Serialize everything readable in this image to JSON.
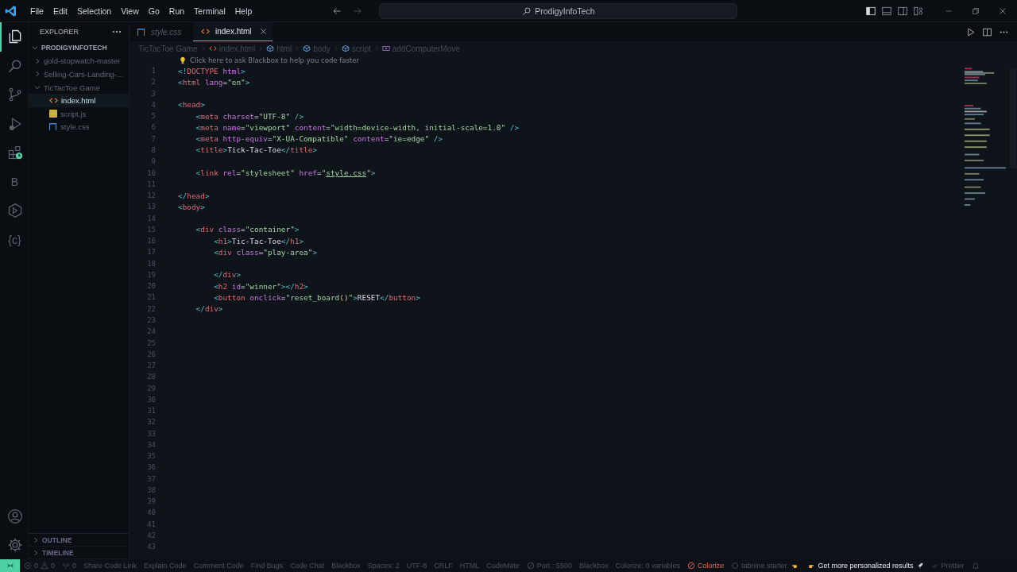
{
  "menu": [
    "File",
    "Edit",
    "Selection",
    "View",
    "Go",
    "Run",
    "Terminal",
    "Help"
  ],
  "command_center": {
    "value": "ProdigyInfoTech"
  },
  "layout_buttons": [
    {
      "kind": "sidebar-left",
      "on": true
    },
    {
      "kind": "panel",
      "on": false
    },
    {
      "kind": "sidebar-right",
      "on": false
    },
    {
      "kind": "layout",
      "on": false
    }
  ],
  "activity_bar": [
    {
      "kind": "files",
      "selected": true
    },
    {
      "kind": "search",
      "selected": false
    },
    {
      "kind": "branch",
      "selected": false
    },
    {
      "kind": "debug",
      "selected": false
    },
    {
      "kind": "extensions",
      "selected": false
    },
    {
      "kind": "letter",
      "label": "B",
      "selected": false
    },
    {
      "kind": "cube",
      "selected": false
    },
    {
      "kind": "letter",
      "label": "{c}",
      "selected": false
    }
  ],
  "activity_bottom": [
    {
      "kind": "account"
    },
    {
      "kind": "gear"
    }
  ],
  "sidebar": {
    "title": "EXPLORER",
    "root": {
      "label": "PRODIGYINFOTECH",
      "expanded": true,
      "children": [
        {
          "label": "gold-stopwatch-master",
          "kind": "folder",
          "expanded": false,
          "selected": false
        },
        {
          "label": "Selling-Cars-Landing-...",
          "kind": "folder",
          "expanded": false,
          "selected": false
        },
        {
          "label": "TicTacToe Game",
          "kind": "folder",
          "expanded": true,
          "selected": false,
          "children": [
            {
              "label": "index.html",
              "kind": "html",
              "selected": true
            },
            {
              "label": "script.js",
              "kind": "js",
              "selected": false
            },
            {
              "label": "style.css",
              "kind": "css",
              "selected": false
            }
          ]
        }
      ]
    },
    "sections": [
      {
        "label": "OUTLINE",
        "expanded": false
      },
      {
        "label": "TIMELINE",
        "expanded": false
      }
    ]
  },
  "tabs": [
    {
      "label": "style.css",
      "kind": "css",
      "preview": true,
      "selected": false
    },
    {
      "label": "index.html",
      "kind": "html",
      "preview": false,
      "selected": true
    }
  ],
  "breadcrumbs": [
    {
      "label": "TicTacToe Game",
      "kind": "folder"
    },
    {
      "label": "index.html",
      "kind": "html"
    },
    {
      "label": "html",
      "kind": "element"
    },
    {
      "label": "body",
      "kind": "element"
    },
    {
      "label": "script",
      "kind": "element"
    },
    {
      "label": "addComputerMove",
      "kind": "function"
    }
  ],
  "codelens": "Click here to ask Blackbox to help you code faster",
  "code_lines": [
    {
      "number": "1",
      "tokens": [
        {
          "kind": "br",
          "text": "<!"
        },
        {
          "kind": "tag",
          "text": "DOCTYPE"
        },
        {
          "kind": "attr",
          "text": " html"
        },
        {
          "kind": "br",
          "text": ">"
        }
      ]
    },
    {
      "number": "2",
      "tokens": [
        {
          "kind": "br",
          "text": "<"
        },
        {
          "kind": "tag",
          "text": "html"
        },
        {
          "kind": "attr",
          "text": " lang"
        },
        {
          "kind": "txt",
          "text": "="
        },
        {
          "kind": "str",
          "text": "\"en\""
        },
        {
          "kind": "br",
          "text": ">"
        }
      ]
    },
    {
      "number": "3"
    },
    {
      "number": "4",
      "tokens": [
        {
          "kind": "br",
          "text": "<"
        },
        {
          "kind": "tag",
          "text": "head"
        },
        {
          "kind": "br",
          "text": ">"
        }
      ]
    },
    {
      "number": "5",
      "tokens": [
        {
          "kind": "br",
          "text": "    <"
        },
        {
          "kind": "tag",
          "text": "meta"
        },
        {
          "kind": "attr",
          "text": " charset"
        },
        {
          "kind": "txt",
          "text": "="
        },
        {
          "kind": "str",
          "text": "\"UTF-8\""
        },
        {
          "kind": "br",
          "text": " />"
        }
      ]
    },
    {
      "number": "6",
      "tokens": [
        {
          "kind": "br",
          "text": "    <"
        },
        {
          "kind": "tag",
          "text": "meta"
        },
        {
          "kind": "attr",
          "text": " name"
        },
        {
          "kind": "txt",
          "text": "="
        },
        {
          "kind": "str",
          "text": "\"viewport\""
        },
        {
          "kind": "attr",
          "text": " content"
        },
        {
          "kind": "txt",
          "text": "="
        },
        {
          "kind": "str",
          "text": "\"width=device-width, initial-scale=1.0\""
        },
        {
          "kind": "br",
          "text": " />"
        }
      ]
    },
    {
      "number": "7",
      "tokens": [
        {
          "kind": "br",
          "text": "    <"
        },
        {
          "kind": "tag",
          "text": "meta"
        },
        {
          "kind": "attr",
          "text": " http-equiv"
        },
        {
          "kind": "txt",
          "text": "="
        },
        {
          "kind": "str",
          "text": "\"X-UA-Compatible\""
        },
        {
          "kind": "attr",
          "text": " content"
        },
        {
          "kind": "txt",
          "text": "="
        },
        {
          "kind": "str",
          "text": "\"ie=edge\""
        },
        {
          "kind": "br",
          "text": " />"
        }
      ]
    },
    {
      "number": "8",
      "tokens": [
        {
          "kind": "br",
          "text": "    <"
        },
        {
          "kind": "tag",
          "text": "title"
        },
        {
          "kind": "br",
          "text": ">"
        },
        {
          "kind": "txt",
          "text": "Tick-Tac-Toe"
        },
        {
          "kind": "br",
          "text": "</"
        },
        {
          "kind": "tag",
          "text": "title"
        },
        {
          "kind": "br",
          "text": ">"
        }
      ]
    },
    {
      "number": "9"
    },
    {
      "number": "10",
      "tokens": [
        {
          "kind": "br",
          "text": "    <"
        },
        {
          "kind": "tag",
          "text": "link"
        },
        {
          "kind": "attr",
          "text": " rel"
        },
        {
          "kind": "txt",
          "text": "="
        },
        {
          "kind": "str",
          "text": "\"stylesheet\""
        },
        {
          "kind": "attr",
          "text": " href"
        },
        {
          "kind": "txt",
          "text": "="
        },
        {
          "kind": "str",
          "text": "\""
        },
        {
          "kind": "link",
          "text": "style.css"
        },
        {
          "kind": "str",
          "text": "\""
        },
        {
          "kind": "br",
          "text": ">"
        }
      ]
    },
    {
      "number": "11"
    },
    {
      "number": "12",
      "tokens": [
        {
          "kind": "br",
          "text": "</"
        },
        {
          "kind": "tag",
          "text": "head"
        },
        {
          "kind": "br",
          "text": ">"
        }
      ]
    },
    {
      "number": "13",
      "tokens": [
        {
          "kind": "br",
          "text": "<"
        },
        {
          "kind": "tag",
          "text": "body"
        },
        {
          "kind": "br",
          "text": ">"
        }
      ]
    },
    {
      "number": "14"
    },
    {
      "number": "15",
      "tokens": [
        {
          "kind": "br",
          "text": "    <"
        },
        {
          "kind": "tag",
          "text": "div"
        },
        {
          "kind": "attr",
          "text": " class"
        },
        {
          "kind": "txt",
          "text": "="
        },
        {
          "kind": "str",
          "text": "\"container\""
        },
        {
          "kind": "br",
          "text": ">"
        }
      ]
    },
    {
      "number": "16",
      "tokens": [
        {
          "kind": "br",
          "text": "        <"
        },
        {
          "kind": "tag",
          "text": "h1"
        },
        {
          "kind": "br",
          "text": ">"
        },
        {
          "kind": "txt",
          "text": "Tic-Tac-Toe"
        },
        {
          "kind": "br",
          "text": "</"
        },
        {
          "kind": "tag",
          "text": "h1"
        },
        {
          "kind": "br",
          "text": ">"
        }
      ]
    },
    {
      "number": "17",
      "tokens": [
        {
          "kind": "br",
          "text": "        <"
        },
        {
          "kind": "tag",
          "text": "div"
        },
        {
          "kind": "attr",
          "text": " class"
        },
        {
          "kind": "txt",
          "text": "="
        },
        {
          "kind": "str",
          "text": "\"play-area\""
        },
        {
          "kind": "br",
          "text": ">"
        }
      ]
    },
    {
      "number": "18"
    },
    {
      "number": "19",
      "tokens": [
        {
          "kind": "br",
          "text": "        </"
        },
        {
          "kind": "tag",
          "text": "div"
        },
        {
          "kind": "br",
          "text": ">"
        }
      ]
    },
    {
      "number": "20",
      "tokens": [
        {
          "kind": "br",
          "text": "        <"
        },
        {
          "kind": "tag",
          "text": "h2"
        },
        {
          "kind": "attr",
          "text": " id"
        },
        {
          "kind": "txt",
          "text": "="
        },
        {
          "kind": "str",
          "text": "\"winner\""
        },
        {
          "kind": "br",
          "text": "></"
        },
        {
          "kind": "tag",
          "text": "h2"
        },
        {
          "kind": "br",
          "text": ">"
        }
      ]
    },
    {
      "number": "21",
      "tokens": [
        {
          "kind": "br",
          "text": "        <"
        },
        {
          "kind": "tag",
          "text": "button"
        },
        {
          "kind": "attr",
          "text": " onclick"
        },
        {
          "kind": "txt",
          "text": "="
        },
        {
          "kind": "str",
          "text": "\"reset_board"
        },
        {
          "kind": "paren",
          "text": "()"
        },
        {
          "kind": "str",
          "text": "\""
        },
        {
          "kind": "br",
          "text": ">"
        },
        {
          "kind": "txt",
          "text": "RESET"
        },
        {
          "kind": "br",
          "text": "</"
        },
        {
          "kind": "tag",
          "text": "button"
        },
        {
          "kind": "br",
          "text": ">"
        }
      ]
    },
    {
      "number": "22",
      "tokens": [
        {
          "kind": "br",
          "text": "    </"
        },
        {
          "kind": "tag",
          "text": "div"
        },
        {
          "kind": "br",
          "text": ">"
        }
      ]
    },
    {
      "number": "23"
    },
    {
      "number": "24"
    },
    {
      "number": "25"
    },
    {
      "number": "26"
    },
    {
      "number": "27"
    },
    {
      "number": "28"
    },
    {
      "number": "29"
    },
    {
      "number": "30"
    },
    {
      "number": "31"
    },
    {
      "number": "32"
    },
    {
      "number": "33"
    },
    {
      "number": "34"
    },
    {
      "number": "35"
    },
    {
      "number": "36"
    },
    {
      "number": "37"
    },
    {
      "number": "38"
    },
    {
      "number": "39"
    },
    {
      "number": "40"
    },
    {
      "number": "41"
    },
    {
      "number": "42"
    },
    {
      "number": "43"
    }
  ],
  "status_bar": [
    {
      "kind": "remote"
    },
    {
      "kind": "problems",
      "errors": "0",
      "warnings": "0"
    },
    {
      "kind": "ports",
      "text": "0"
    },
    {
      "kind": "text",
      "text": "Share Code Link"
    },
    {
      "kind": "text",
      "text": "Explain Code"
    },
    {
      "kind": "text",
      "text": "Comment Code"
    },
    {
      "kind": "text",
      "text": "Find Bugs"
    },
    {
      "kind": "text",
      "text": "Code Chat"
    },
    {
      "kind": "text",
      "text": "Blackbox"
    },
    {
      "kind": "text",
      "text": "Spaces: 2"
    },
    {
      "kind": "text",
      "text": "UTF-8"
    },
    {
      "kind": "text",
      "text": "CRLF"
    },
    {
      "kind": "text",
      "text": "HTML"
    },
    {
      "kind": "text",
      "text": "CodeMate"
    },
    {
      "kind": "blocked",
      "text": "Port : 5500"
    },
    {
      "kind": "text",
      "text": "Blackbox"
    },
    {
      "kind": "text",
      "text": "Colorize: 0 variables"
    },
    {
      "kind": "error",
      "text": "Colorize"
    },
    {
      "kind": "tabnine",
      "text": "tabnine starter"
    },
    {
      "kind": "promo",
      "text": "Get more personalized results"
    },
    {
      "kind": "prettier",
      "text": "Prettier"
    },
    {
      "kind": "bell"
    }
  ]
}
